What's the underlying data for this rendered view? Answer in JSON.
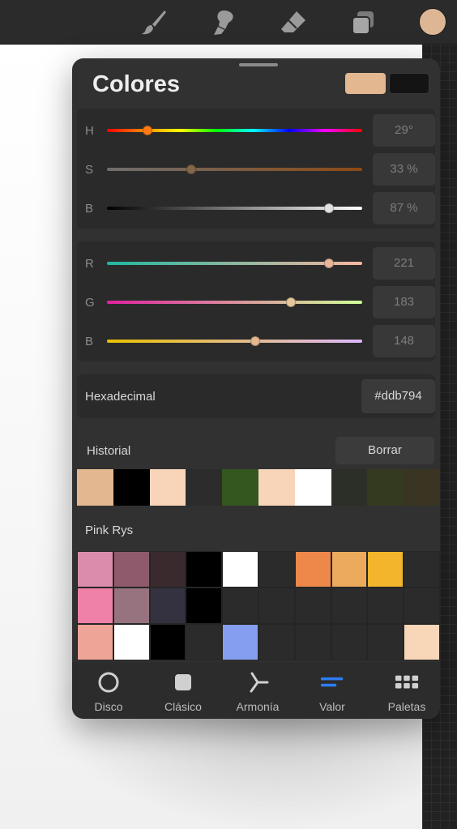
{
  "toolbar": {
    "tools": [
      {
        "name": "brush-icon"
      },
      {
        "name": "smudge-icon"
      },
      {
        "name": "eraser-icon"
      },
      {
        "name": "layers-icon"
      }
    ],
    "current_color": "#ddb794"
  },
  "panel": {
    "title": "Colores",
    "primary_color": "#e3b78f",
    "secondary_color": "#141414"
  },
  "hsb": [
    {
      "label": "H",
      "value": "29°",
      "fraction": 0.16
    },
    {
      "label": "S",
      "value": "33 %",
      "fraction": 0.33
    },
    {
      "label": "B",
      "value": "87 %",
      "fraction": 0.87
    }
  ],
  "rgb": [
    {
      "label": "R",
      "value": "221",
      "fraction": 0.87
    },
    {
      "label": "G",
      "value": "183",
      "fraction": 0.72
    },
    {
      "label": "B",
      "value": "148",
      "fraction": 0.58
    }
  ],
  "hex": {
    "label": "Hexadecimal",
    "value": "#ddb794"
  },
  "history": {
    "label": "Historial",
    "clear_label": "Borrar",
    "colors": [
      "#e3b78f",
      "#000000",
      "#f8d5b9",
      "#2c2c2c",
      "#34561f",
      "#f8d5b9",
      "#ffffff",
      "#2b2f28",
      "#343a1f",
      "#3a3522"
    ]
  },
  "palette": {
    "name": "Pink Rys",
    "colors": [
      "#db8bac",
      "#8e5a6c",
      "#3a2a2e",
      "#000000",
      "#ffffff",
      "#2b2b2b",
      "#ed874a",
      "#ebaa5c",
      "#f3b52b",
      "#2b2b2b",
      "#ef80a8",
      "#97727f",
      "#343240",
      "#000000",
      "#2b2b2b",
      "#2b2b2b",
      "#2b2b2b",
      "#2b2b2b",
      "#2b2b2b",
      "#2b2b2b",
      "#eea496",
      "#ffffff",
      "#000000",
      "#2b2b2b",
      "#869ef0",
      "#2b2b2b",
      "#2b2b2b",
      "#2b2b2b",
      "#2b2b2b",
      "#f8d7b8"
    ]
  },
  "tabs": [
    {
      "label": "Disco",
      "icon": "disc-icon",
      "active": false
    },
    {
      "label": "Clásico",
      "icon": "classic-icon",
      "active": false
    },
    {
      "label": "Armonía",
      "icon": "harmony-icon",
      "active": false
    },
    {
      "label": "Valor",
      "icon": "value-icon",
      "active": true
    },
    {
      "label": "Paletas",
      "icon": "palettes-icon",
      "active": false
    }
  ],
  "colors": {
    "accent": "#2f7df6"
  }
}
